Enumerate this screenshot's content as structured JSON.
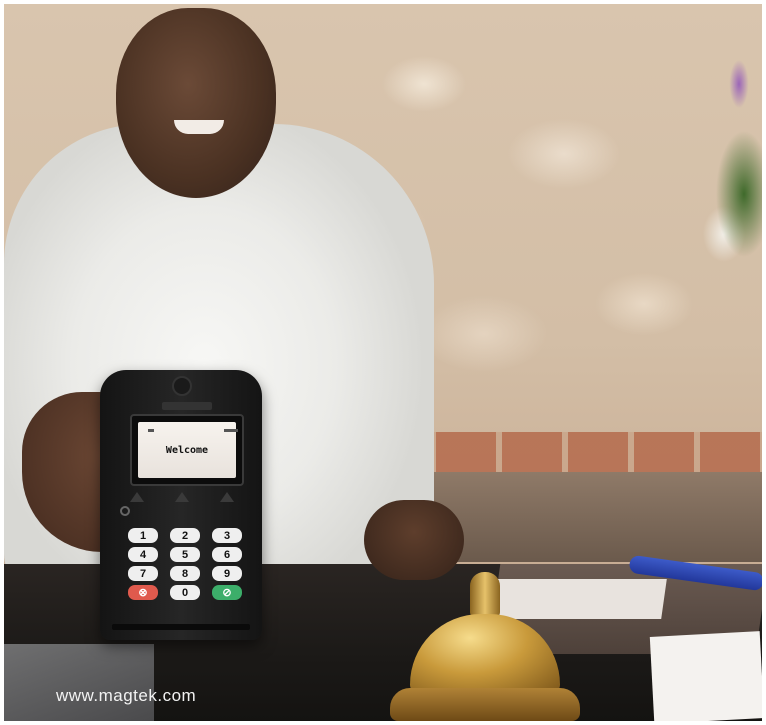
{
  "terminal": {
    "screen_text": "Welcome",
    "keys": [
      {
        "label": "1",
        "kind": "digit"
      },
      {
        "label": "2",
        "kind": "digit"
      },
      {
        "label": "3",
        "kind": "digit"
      },
      {
        "label": "4",
        "kind": "digit"
      },
      {
        "label": "5",
        "kind": "digit"
      },
      {
        "label": "6",
        "kind": "digit"
      },
      {
        "label": "7",
        "kind": "digit"
      },
      {
        "label": "8",
        "kind": "digit"
      },
      {
        "label": "9",
        "kind": "digit"
      },
      {
        "label": "⊗",
        "kind": "cancel"
      },
      {
        "label": "0",
        "kind": "digit"
      },
      {
        "label": "⊘",
        "kind": "enter"
      }
    ],
    "colors": {
      "cancel": "#e05a4d",
      "enter": "#3cae6a",
      "body": "#1f1f1f"
    }
  },
  "watermark": {
    "text": "www.magtek.com"
  }
}
